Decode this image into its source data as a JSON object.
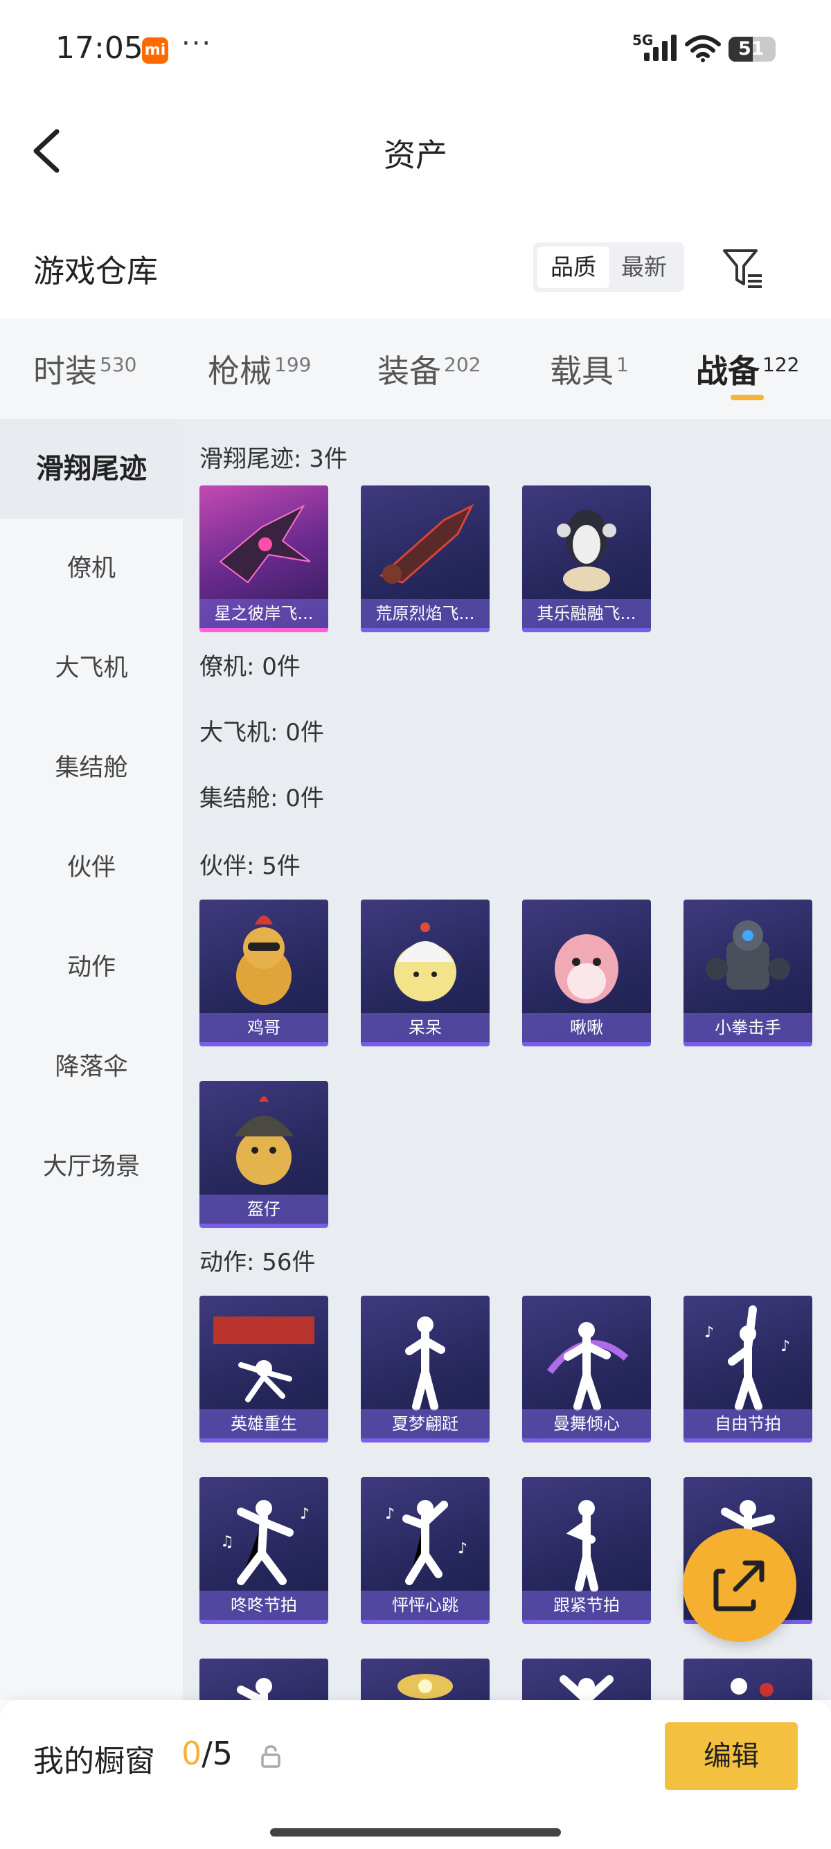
{
  "status_bar": {
    "time": "17:05",
    "mi_badge": "mi",
    "dots": "···",
    "network": "5G",
    "battery": "51"
  },
  "header": {
    "title": "资产"
  },
  "section": {
    "title": "游戏仓库",
    "sort_options": [
      "品质",
      "最新"
    ],
    "sort_active": "品质"
  },
  "category_tabs": [
    {
      "label": "时装",
      "count": "530"
    },
    {
      "label": "枪械",
      "count": "199"
    },
    {
      "label": "装备",
      "count": "202"
    },
    {
      "label": "载具",
      "count": "1"
    },
    {
      "label": "战备",
      "count": "122"
    }
  ],
  "category_active": "战备",
  "sidebar": {
    "items": [
      "滑翔尾迹",
      "僚机",
      "大飞机",
      "集结舱",
      "伙伴",
      "动作",
      "降落伞",
      "大厅场景"
    ],
    "active": "滑翔尾迹"
  },
  "groups": [
    {
      "label": "滑翔尾迹: 3件",
      "items": [
        "星之彼岸飞...",
        "荒原烈焰飞...",
        "其乐融融飞..."
      ]
    },
    {
      "label": "僚机: 0件",
      "items": []
    },
    {
      "label": "大飞机: 0件",
      "items": []
    },
    {
      "label": "集结舱: 0件",
      "items": []
    },
    {
      "label": "伙伴: 5件",
      "items": [
        "鸡哥",
        "呆呆",
        "啾啾",
        "小拳击手",
        "盔仔"
      ]
    },
    {
      "label": "动作: 56件",
      "items": [
        "英雄重生",
        "夏梦翩跹",
        "曼舞倾心",
        "自由节拍",
        "咚咚节拍",
        "怦怦心跳",
        "跟紧节拍",
        "",
        "",
        "",
        "",
        ""
      ]
    }
  ],
  "bottom_bar": {
    "label": "我的橱窗",
    "count_current": "0",
    "count_total": "/5",
    "edit_label": "编辑"
  },
  "colors": {
    "accent": "#f4b43a",
    "card_bg": "#2b2a66",
    "legendary": "#c44ab2",
    "content_bg": "#e9edf1"
  }
}
